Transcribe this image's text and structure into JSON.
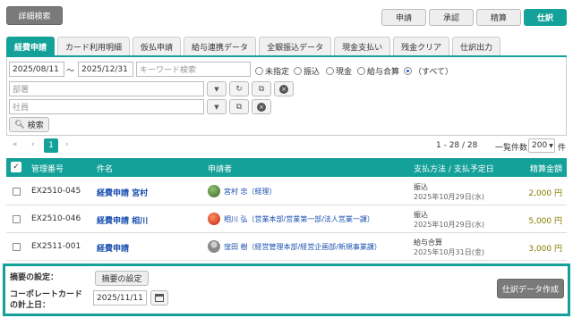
{
  "header": {
    "detail_search": "詳細検索",
    "top_tabs": [
      "申請",
      "承認",
      "精算",
      "仕訳"
    ]
  },
  "tabs": [
    "経費申請",
    "カード利用明細",
    "仮払申請",
    "給与連携データ",
    "全銀振込データ",
    "現金支払い",
    "残金クリア",
    "仕訳出力"
  ],
  "filters": {
    "date_from": "2025/08/11",
    "date_sep": "〜",
    "date_to": "2025/12/31",
    "keyword_placeholder": "キーワード検索",
    "payment_options": [
      "未指定",
      "振込",
      "現金",
      "給与合算",
      "（すべて）"
    ],
    "payment_selected": "（すべて）",
    "department_placeholder": "部署",
    "employee_placeholder": "社員",
    "search_label": "検索"
  },
  "pagination": {
    "first": "«",
    "prev": "‹",
    "current": "1",
    "next": "›",
    "range_text": "1 - 28 / 28",
    "per_page_label": "一覧件数：",
    "per_page": "200",
    "per_page_unit": "件"
  },
  "table": {
    "check_all": "✓",
    "headers": [
      "管理番号",
      "件名",
      "申請者",
      "支払方法 / 支払予定日",
      "精算金額"
    ],
    "rows": [
      {
        "id": "EX2510-045",
        "subject": "経費申請 宮村",
        "applicant": "宮村 忠（経理）",
        "method": "振込",
        "date": "2025年10月29日(水)",
        "amount": "2,000 円",
        "avatar_color": "#4a7a3a"
      },
      {
        "id": "EX2510-046",
        "subject": "経費申請 相川",
        "applicant": "相川 弘（営業本部/営業第一部/法人営業一課）",
        "method": "振込",
        "date": "2025年10月29日(水)",
        "amount": "5,000 円",
        "avatar_color": "#d03a1a"
      },
      {
        "id": "EX2511-001",
        "subject": "経費申請",
        "applicant": "窪田 樹（経営管理本部/経営企画部/新規事業課）",
        "method": "給与合算",
        "date": "2025年10月31日(金)",
        "amount": "3,000 円",
        "avatar_color": "#9a9a9a"
      }
    ]
  },
  "bottom": {
    "summary_label": "摘要の設定：",
    "summary_button": "摘要の設定",
    "corp_card_label_1": "コーポレートカード",
    "corp_card_label_2": "の計上日：",
    "corp_card_date": "2025/11/11",
    "create_journal": "仕訳データ作成"
  },
  "colors": {
    "accent": "#14a19a",
    "link": "#1a4fb0",
    "amount": "#8a7a00"
  }
}
